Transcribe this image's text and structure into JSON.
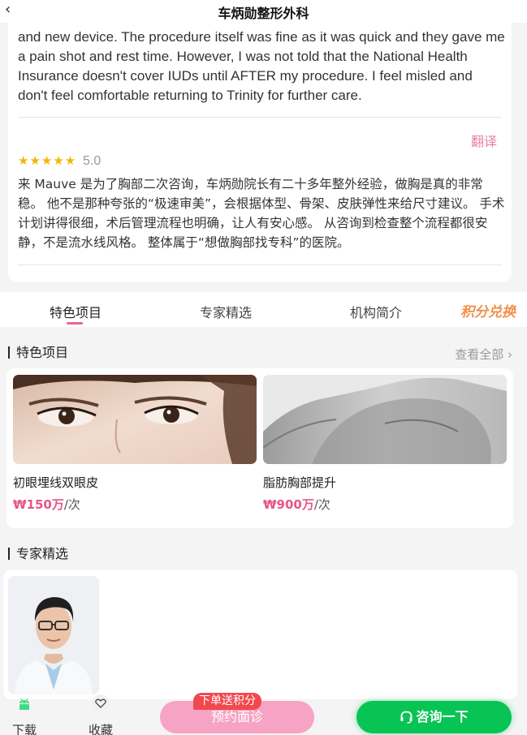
{
  "header": {
    "title": "车炳勋整形外科",
    "back_icon": "chevron-left-icon"
  },
  "review_en": {
    "text": "and new device. The procedure itself was fine as it was quick and they gave me a pain shot and rest time. However, I was not told that the National Health Insurance doesn't cover IUDs until AFTER my procedure. I feel misled and don't feel comfortable returning to Trinity for further care."
  },
  "translate_label": "翻译",
  "review_zh": {
    "stars": "★★★★★",
    "rating": "5.0",
    "star_count": 5,
    "text": "来 Mauve 是为了胸部二次咨询，车炳勋院长有二十多年整外经验，做胸是真的非常稳。 他不是那种夸张的“极速审美”，会根据体型、骨架、皮肤弹性来给尺寸建议。 手术计划讲得很细，术后管理流程也明确，让人有安心感。 从咨询到检查整个流程都很安静，不是流水线风格。 整体属于“想做胸部找专科”的医院。"
  },
  "tabs": [
    {
      "label": "特色项目",
      "active": true
    },
    {
      "label": "专家精选",
      "active": false
    },
    {
      "label": "机构简介",
      "active": false
    }
  ],
  "points_exchange": "积分兑换",
  "featured": {
    "title": "特色项目",
    "view_all": "查看全部",
    "items": [
      {
        "name": "初眼埋线双眼皮",
        "price": "₩150万",
        "unit": "/次"
      },
      {
        "name": "脂肪胸部提升",
        "price": "₩900万",
        "unit": "/次"
      }
    ]
  },
  "experts": {
    "title": "专家精选"
  },
  "bottom_bar": {
    "download": "下载",
    "favorite": "收藏",
    "promo": "下单送积分",
    "book": "预约面诊",
    "consult": "咨询一下"
  },
  "colors": {
    "accent_pink": "#e8649a",
    "price_pink": "#e8548a",
    "book_button": "#f7a3c3",
    "consult_green": "#08c455",
    "promo_red": "#f1484f",
    "star_gold": "#f5b400"
  }
}
